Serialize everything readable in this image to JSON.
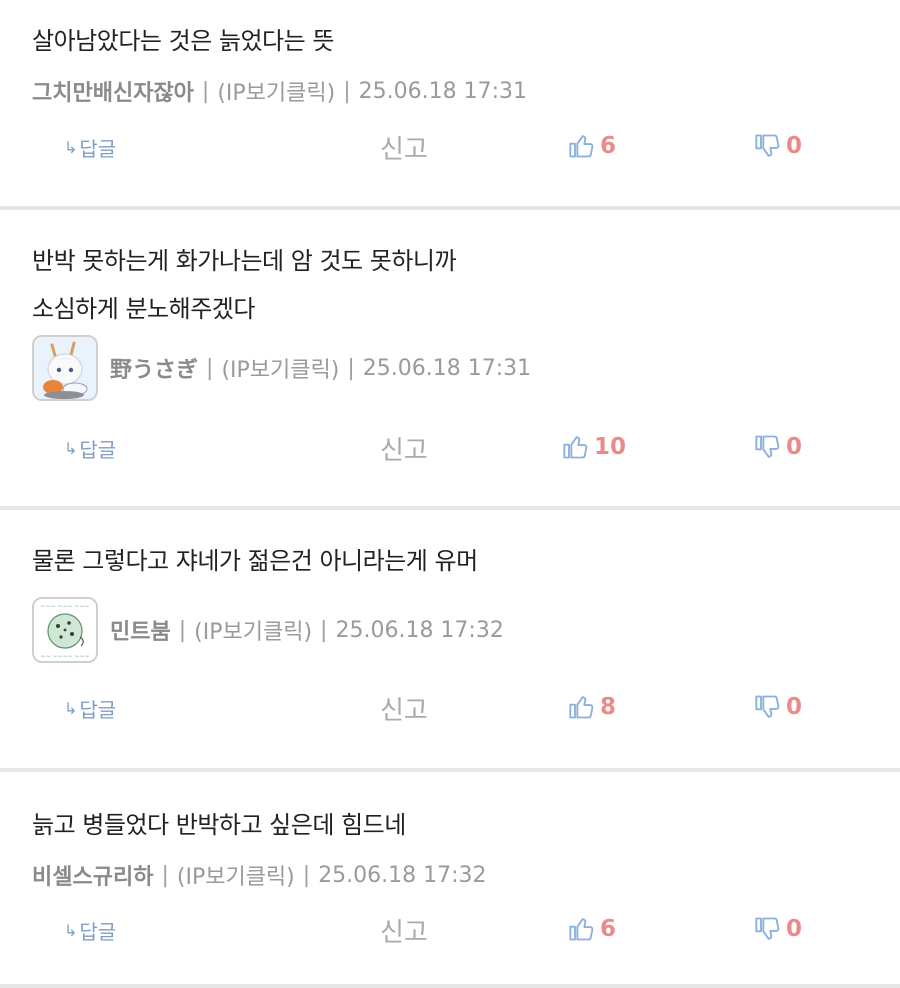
{
  "colors": {
    "text": "#222222",
    "meta": "#9a9a9a",
    "reply": "#7f9ec5",
    "report": "#aaaaaa",
    "vote_icon": "#8ab0de",
    "vote_count": "#ea8a8a",
    "divider": "#e6e6e6"
  },
  "comments": [
    {
      "text": "살아남았다는 것은 늙었다는 뜻",
      "nickname": "그치만배신자잖아",
      "ip_label": "(IP보기클릭)",
      "timestamp": "25.06.18 17:31",
      "has_avatar": false,
      "reply_label": "답글",
      "report_label": "신고",
      "likes": "6",
      "dislikes": "0"
    },
    {
      "text": "반박 못하는게 화가나는데 암 것도 못하니까\n소심하게 분노해주겠다",
      "nickname": "野うさぎ",
      "ip_label": "(IP보기클릭)",
      "timestamp": "25.06.18 17:31",
      "has_avatar": true,
      "avatar_icon": "rabbit-girl-avatar",
      "reply_label": "답글",
      "report_label": "신고",
      "likes": "10",
      "dislikes": "0"
    },
    {
      "text": "물론 그렇다고 쟈네가 젊은건 아니라는게 유머",
      "nickname": "민트붐",
      "ip_label": "(IP보기클릭)",
      "timestamp": "25.06.18 17:32",
      "has_avatar": true,
      "avatar_icon": "mint-chocolate-avatar",
      "reply_label": "답글",
      "report_label": "신고",
      "likes": "8",
      "dislikes": "0"
    },
    {
      "text": "늙고 병들었다 반박하고 싶은데 힘드네",
      "nickname": "비셀스규리하",
      "ip_label": "(IP보기클릭)",
      "timestamp": "25.06.18 17:32",
      "has_avatar": false,
      "reply_label": "답글",
      "report_label": "신고",
      "likes": "6",
      "dislikes": "0"
    }
  ],
  "icons": {
    "reply": "reply-arrow-icon",
    "like": "thumbs-up-icon",
    "dislike": "thumbs-down-icon"
  }
}
